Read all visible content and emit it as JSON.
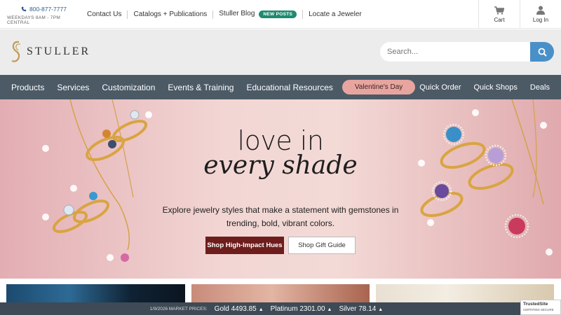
{
  "topbar": {
    "phone": "800-877-7777",
    "hours": "WEEKDAYS 8AM - 7PM CENTRAL",
    "links": [
      "Contact Us",
      "Catalogs + Publications",
      "Stuller Blog",
      "Locate a Jeweler"
    ],
    "new_posts_badge": "NEW POSTS",
    "cart_label": "Cart",
    "login_label": "Log In"
  },
  "logo": {
    "text": "STULLER"
  },
  "search": {
    "placeholder": "Search..."
  },
  "nav": {
    "items": [
      "Products",
      "Services",
      "Customization",
      "Events & Training",
      "Educational Resources"
    ],
    "valentine": "Valentine's Day",
    "right_items": [
      "Quick Order",
      "Quick Shops",
      "Deals"
    ]
  },
  "hero": {
    "title_line1": "love in",
    "title_line2": "every shade",
    "text": "Explore jewelry styles that make a statement with gemstones in trending, bold, vibrant colors.",
    "cta_primary": "Shop High-Impact Hues",
    "cta_secondary": "Shop Gift Guide"
  },
  "ticker": {
    "label": "1/9/2026 MARKET PRICES:",
    "gold": "Gold 4493.85",
    "platinum": "Platinum 2301.00",
    "silver": "Silver 78.14"
  },
  "trusted": {
    "title": "TrustedSite",
    "subtitle": "CERTIFIED SECURE"
  },
  "colors": {
    "nav_bg": "#4c5a66",
    "accent_blue": "#4a90c8",
    "cta_primary": "#6e1d1d",
    "valentine_pill": "#e8a5a0",
    "new_badge": "#1f8a70"
  }
}
